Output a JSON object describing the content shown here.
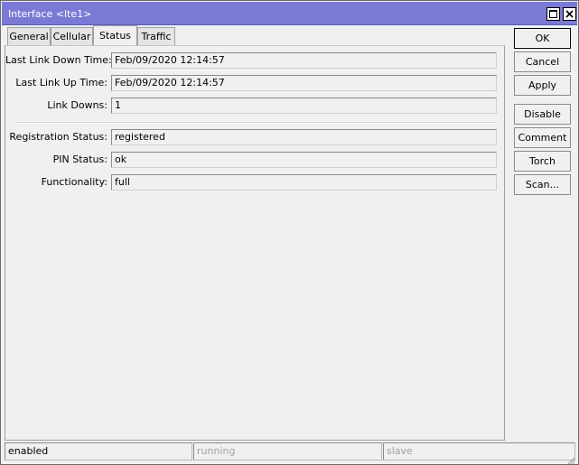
{
  "window": {
    "title": "Interface <lte1>"
  },
  "tabs": [
    {
      "label": "General"
    },
    {
      "label": "Cellular"
    },
    {
      "label": "Status"
    },
    {
      "label": "Traffic"
    }
  ],
  "fields": {
    "last_link_down_time": {
      "label": "Last Link Down Time:",
      "value": "Feb/09/2020 12:14:57"
    },
    "last_link_up_time": {
      "label": "Last Link Up Time:",
      "value": "Feb/09/2020 12:14:57"
    },
    "link_downs": {
      "label": "Link Downs:",
      "value": "1"
    },
    "registration_status": {
      "label": "Registration Status:",
      "value": "registered"
    },
    "pin_status": {
      "label": "PIN Status:",
      "value": "ok"
    },
    "functionality": {
      "label": "Functionality:",
      "value": "full"
    }
  },
  "buttons": {
    "ok": "OK",
    "cancel": "Cancel",
    "apply": "Apply",
    "disable": "Disable",
    "comment": "Comment",
    "torch": "Torch",
    "scan": "Scan..."
  },
  "statusbar": {
    "enabled": "enabled",
    "running": "running",
    "slave": "slave"
  },
  "colors": {
    "titlebar": "#7a7ad6",
    "background": "#f0f0f0"
  }
}
